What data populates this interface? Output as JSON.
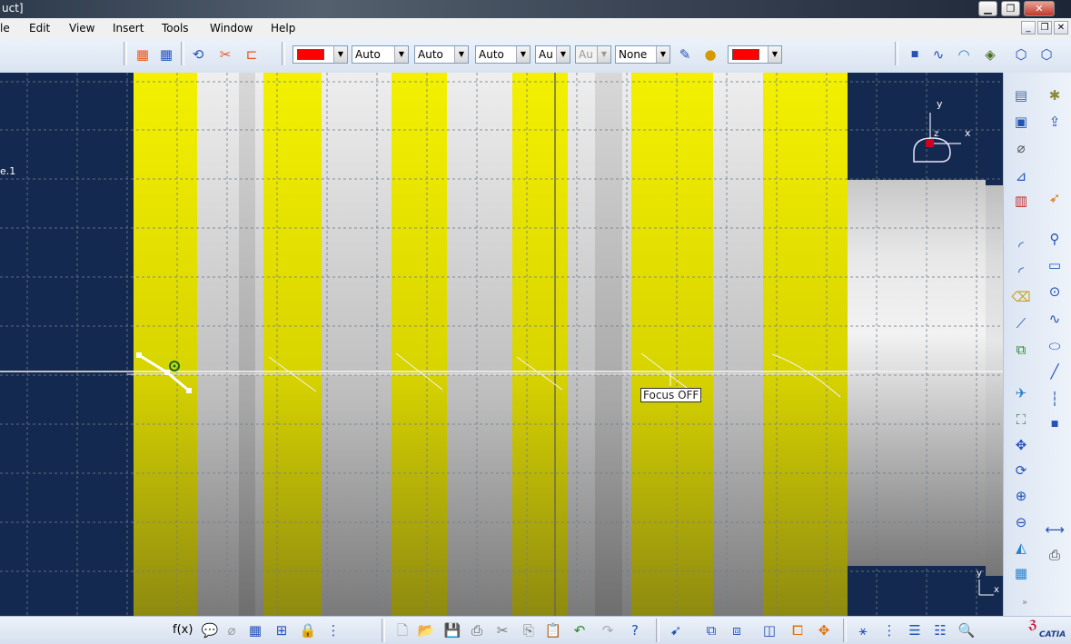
{
  "window": {
    "title": "uct]"
  },
  "menu": [
    {
      "label": "le"
    },
    {
      "label": "Edit"
    },
    {
      "label": "View"
    },
    {
      "label": "Insert"
    },
    {
      "label": "Tools"
    },
    {
      "label": "Window"
    },
    {
      "label": "Help"
    }
  ],
  "toolbar": {
    "line_color": "#ff0000",
    "line_type": "Auto",
    "line_thickness": "Auto",
    "point_type": "Auto",
    "layer": "Au",
    "layer_disabled": "Au",
    "render_style": "None",
    "fill_color": "#ff0000"
  },
  "viewport": {
    "tree_label": "e.1",
    "tooltip": "Focus OFF",
    "compass": {
      "y": "y",
      "x": "x",
      "z": "z"
    },
    "axis": {
      "y": "y",
      "x": "x"
    }
  },
  "brand": {
    "logo_text": "CATIA"
  },
  "colors": {
    "background": "#14294f",
    "part_yellow": "#f0ec00",
    "accent": "#ff0000"
  }
}
